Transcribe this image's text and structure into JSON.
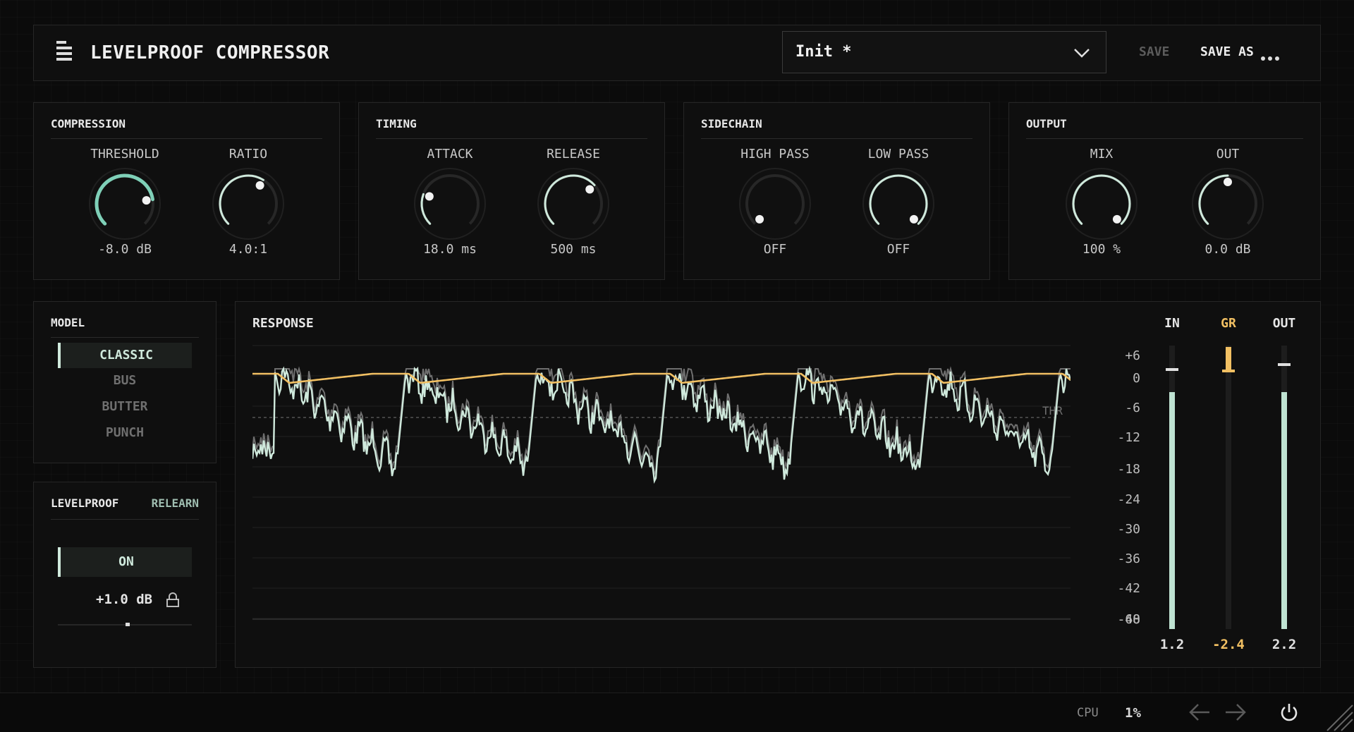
{
  "header": {
    "title": "LEVELPROOF COMPRESSOR",
    "preset": "Init *",
    "save_label": "SAVE",
    "save_as_label": "SAVE AS",
    "menu_icon": "hamburger-icon",
    "more_icon": "ellipsis-icon"
  },
  "sections": {
    "compression": {
      "title": "COMPRESSION",
      "knobs": [
        {
          "label": "THRESHOLD",
          "value": "-8.0 dB",
          "level": 0.8,
          "accent": true
        },
        {
          "label": "RATIO",
          "value": "4.0:1",
          "level": 0.62,
          "accent": false
        }
      ]
    },
    "timing": {
      "title": "TIMING",
      "knobs": [
        {
          "label": "ATTACK",
          "value": "18.0 ms",
          "level": 0.24,
          "accent": false
        },
        {
          "label": "RELEASE",
          "value": "500 ms",
          "level": 0.68,
          "accent": false
        }
      ]
    },
    "sidechain": {
      "title": "SIDECHAIN",
      "knobs": [
        {
          "label": "HIGH PASS",
          "value": "OFF",
          "level": 0.0,
          "accent": false
        },
        {
          "label": "LOW PASS",
          "value": "OFF",
          "level": 1.0,
          "accent": false
        }
      ]
    },
    "output": {
      "title": "OUTPUT",
      "knobs": [
        {
          "label": "MIX",
          "value": "100 %",
          "level": 1.0,
          "accent": false
        },
        {
          "label": "OUT",
          "value": "0.0 dB",
          "level": 0.5,
          "accent": false
        }
      ]
    }
  },
  "model": {
    "title": "MODEL",
    "items": [
      "CLASSIC",
      "BUS",
      "BUTTER",
      "PUNCH"
    ],
    "selected": "CLASSIC"
  },
  "levelproof": {
    "title": "LEVELPROOF",
    "relearn_label": "RELEARN",
    "on_label": "ON",
    "gain": "+1.0 dB",
    "lock_icon": "lock-icon",
    "slider_level": 0.52
  },
  "response": {
    "title": "RESPONSE",
    "threshold_label": "THR",
    "scale": [
      "+6",
      "0",
      "-6",
      "-12",
      "-18",
      "-24",
      "-30",
      "-36",
      "-42",
      "-48",
      "-60"
    ]
  },
  "meters": {
    "in": {
      "label": "IN",
      "value": "1.2"
    },
    "gr": {
      "label": "GR",
      "value": "-2.4"
    },
    "out": {
      "label": "OUT",
      "value": "2.2"
    }
  },
  "footer": {
    "cpu_label": "CPU",
    "cpu_value": "1%",
    "undo_icon": "arrow-left-icon",
    "redo_icon": "arrow-right-icon",
    "power_icon": "power-icon"
  },
  "colors": {
    "accent_green": "#cfe9dc",
    "threshold_teal": "#7fd0b8",
    "gain_reduction": "#f2c063",
    "text_dim": "#7a7a7a"
  }
}
